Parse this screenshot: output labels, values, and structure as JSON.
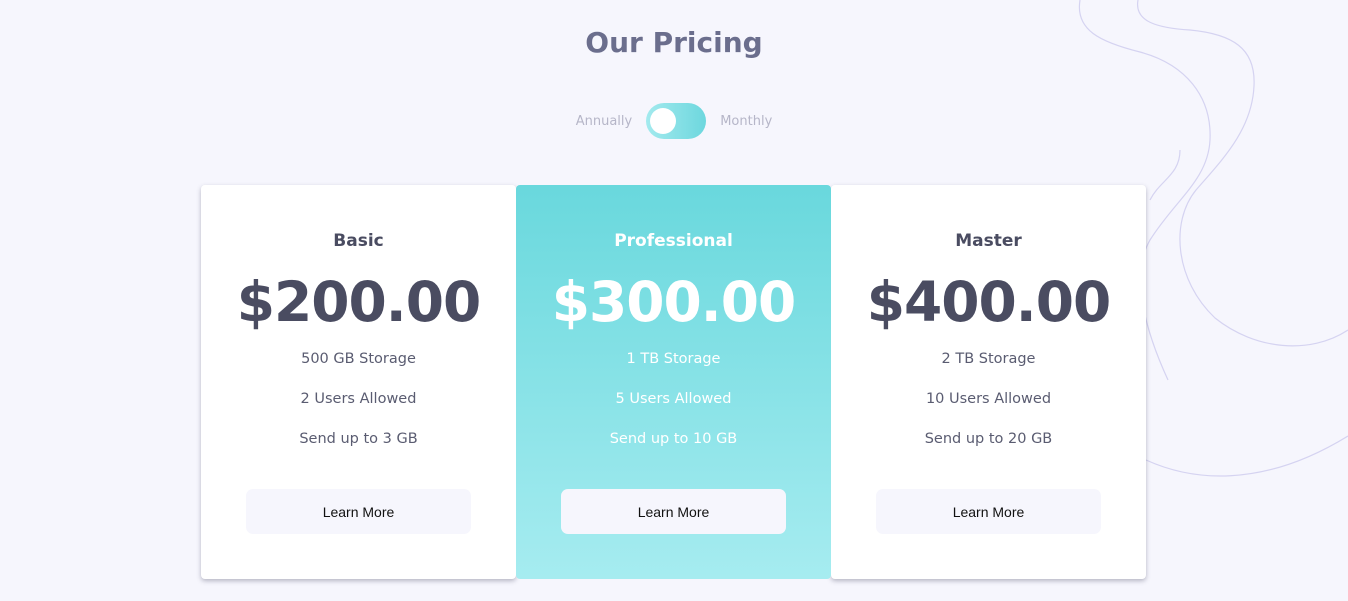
{
  "page": {
    "title": "Our Pricing"
  },
  "billing": {
    "annually_label": "Annually",
    "monthly_label": "Monthly"
  },
  "plans": [
    {
      "name": "Basic",
      "price": "$200.00",
      "features": [
        "500 GB Storage",
        "2 Users Allowed",
        "Send up to 3 GB"
      ],
      "button_label": "Learn More"
    },
    {
      "name": "Professional",
      "price": "$300.00",
      "features": [
        "1 TB Storage",
        "5 Users Allowed",
        "Send up to 10 GB"
      ],
      "button_label": "Learn More"
    },
    {
      "name": "Master",
      "price": "$400.00",
      "features": [
        "2 TB Storage",
        "10 Users Allowed",
        "Send up to 20 GB"
      ],
      "button_label": "Learn More"
    }
  ],
  "colors": {
    "background": "#f6f6fd",
    "title": "#6b6e8d",
    "text_dark": "#4a4c61",
    "accent_gradient_start": "#69d8dd",
    "accent_gradient_end": "#a6ecf0"
  }
}
